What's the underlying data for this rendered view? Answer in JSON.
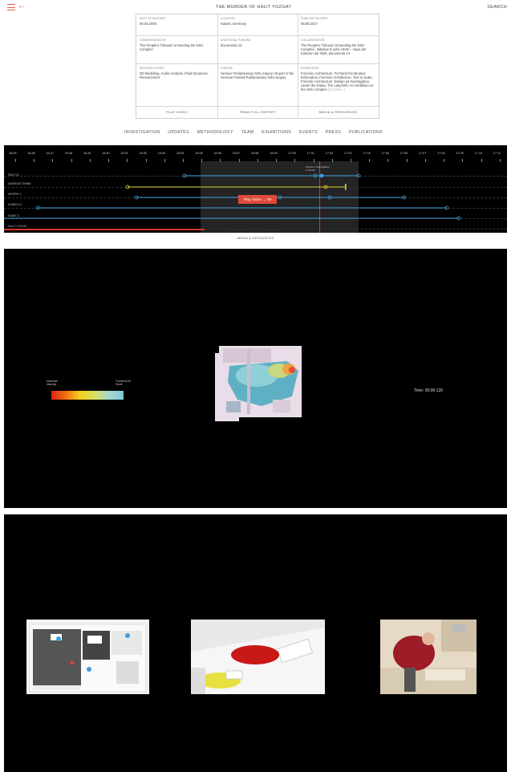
{
  "header": {
    "menu_icon": "menu-icon",
    "back_icon": "back-arrow-icon",
    "title": "THE MURDER OF HALIT YOZGAT",
    "search_label": "SEARCH",
    "accent_color": "#e05a4a"
  },
  "info_table": {
    "cells": [
      {
        "label": "DATE OF INCIDENT",
        "value": "06.04.2006"
      },
      {
        "label": "LOCATION",
        "value": "Kassel, Germany"
      },
      {
        "label": "PUBLICATION DATE",
        "value": "08.08.2017"
      },
      {
        "label": "COMMISSIONED BY",
        "value": "The People's Tribunal 'Unraveling the NSU Complex'"
      },
      {
        "label": "ADDITIONAL FUNDING",
        "value": "documenta 14"
      },
      {
        "label": "COLLABORATION",
        "value": "The People's Tribunal 'Unraveling the NSU Complex', Initiative 6 April, HKW – Haus der Kulturen der Welt, documenta 14"
      },
      {
        "label": "METHODOLOGIES",
        "value": "3D Modelling, Audio Analysis, Fluid Dynamics, Reenactment"
      },
      {
        "label": "FORUMS",
        "value": "Hessen Parliamentary NSU Inquiry; Report of the German Federal Parliamentary NSU-Inquiry"
      },
      {
        "label": "EXHIBITIONS",
        "value": "Forensic Architecture: To Patrol the Bruised Information, Forensic Architecture: Toxi to Scale, Forensic Architecture: Design as Investigation, Under the Radar, The Labyrinth: An exhibition on the NSU complex",
        "more": "(14 more...)"
      }
    ],
    "buttons": [
      "PLAY VIDEO",
      "READ FULL REPORT",
      "MEDIA & RESOURCES"
    ]
  },
  "nav": [
    "INVESTIGATION",
    "UPDATES",
    "METHODOLOGY",
    "TEAM",
    "EXHIBITIONS",
    "EVENTS",
    "PRESS",
    "PUBLICATIONS"
  ],
  "timeline": {
    "ticks": [
      "16:45",
      "16:46",
      "16:47",
      "16:48",
      "16:49",
      "16:50",
      "16:51",
      "16:52",
      "16:53",
      "16:54",
      "16:55",
      "16:56",
      "16:57",
      "16:58",
      "16:59",
      "17:00",
      "17:01",
      "17:02",
      "17:03",
      "17:04",
      "17:05",
      "17:06",
      "17:07",
      "17:08",
      "17:09",
      "17:10",
      "17:11"
    ],
    "rows": [
      "PAID H.K",
      "ANDREAS TEMME",
      "HESPPE C.",
      "AHMED A.T",
      "HAMIE S.",
      "HALIT YOZGAT"
    ],
    "marker_label": "Temme's interrogation: 17:01:09",
    "play_button": "Play Video → 08",
    "bottom_label": "MEDIA & RESOURCES",
    "colors": {
      "cyan": "#3aa0d8",
      "yellow": "#d8d030",
      "red": "#d03a2a"
    }
  },
  "simulation": {
    "legend_left": "Maximum intensity",
    "legend_right": "Threshold for Smell",
    "time_label": "Time: 00:06:120"
  },
  "gallery": {
    "images": [
      "floorplan-3d-model",
      "desk-render",
      "reenactment-photo"
    ]
  }
}
